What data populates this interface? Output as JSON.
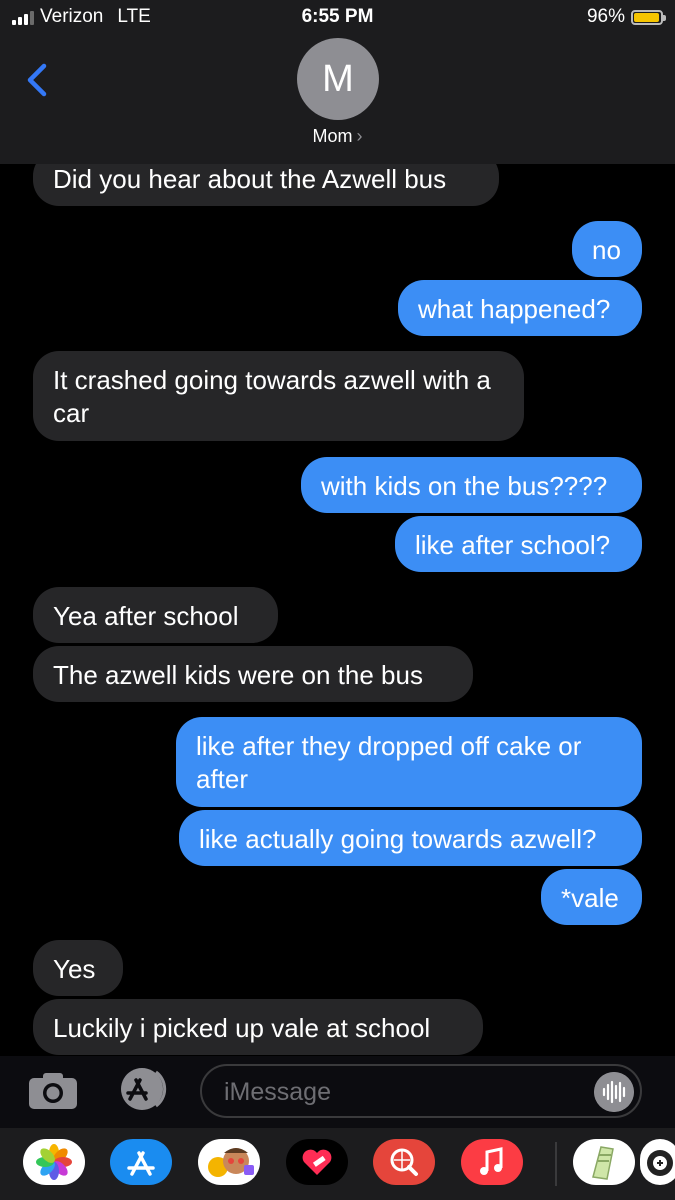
{
  "status": {
    "carrier": "Verizon",
    "network": "LTE",
    "time": "6:55 PM",
    "battery": "96%"
  },
  "header": {
    "avatar_initial": "M",
    "contact_name": "Mom",
    "chevron": "›"
  },
  "messages": [
    {
      "dir": "in",
      "text": "Did you hear about the Azwell bus"
    },
    {
      "dir": "out",
      "text": "no"
    },
    {
      "dir": "out",
      "text": "what happened?"
    },
    {
      "dir": "in",
      "text": "It crashed going towards azwell with a car"
    },
    {
      "dir": "out",
      "text": "with kids on the bus????"
    },
    {
      "dir": "out",
      "text": "like after school?"
    },
    {
      "dir": "in",
      "text": "Yea after school"
    },
    {
      "dir": "in",
      "text": "The azwell kids were on the bus"
    },
    {
      "dir": "out",
      "text": "like after they dropped off cake or after"
    },
    {
      "dir": "out",
      "text": "like actually going towards azwell?"
    },
    {
      "dir": "out",
      "text": "*vale"
    },
    {
      "dir": "in",
      "text": "Yes"
    },
    {
      "dir": "in",
      "text": "Luckily i picked up vale at school"
    }
  ],
  "input": {
    "placeholder": "iMessage"
  },
  "colors": {
    "outgoing": "#3c8ef5",
    "incoming": "#262628",
    "accent": "#3478f6"
  },
  "icons": [
    "back-chevron-icon",
    "camera-icon",
    "app-store-icon",
    "audio-waveform-icon",
    "photos-icon",
    "memoji-icon",
    "heart-sticker-icon",
    "web-search-icon",
    "music-icon",
    "sticker-app-icon",
    "game-app-icon"
  ]
}
